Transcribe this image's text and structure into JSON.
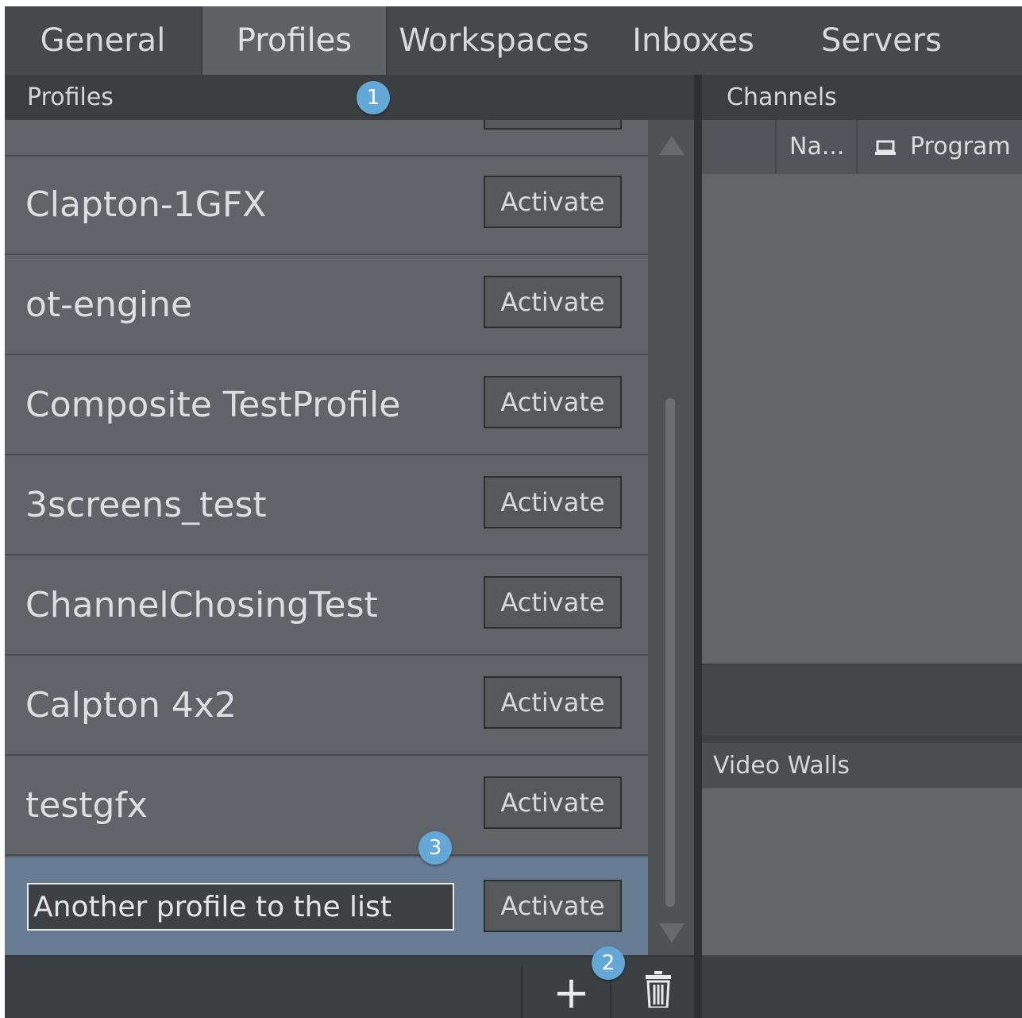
{
  "tabs": [
    {
      "label": "General",
      "active": false
    },
    {
      "label": "Profiles",
      "active": true
    },
    {
      "label": "Workspaces",
      "active": false
    },
    {
      "label": "Inboxes",
      "active": false
    },
    {
      "label": "Servers",
      "active": false
    }
  ],
  "profiles_panel": {
    "title": "Profiles",
    "activate_label": "Activate",
    "items": [
      {
        "name": "Clapton-1GFX"
      },
      {
        "name": "ot-engine"
      },
      {
        "name": "Composite TestProfile"
      },
      {
        "name": "3screens_test"
      },
      {
        "name": "ChannelChosingTest"
      },
      {
        "name": "Calpton 4x2"
      },
      {
        "name": "testgfx"
      }
    ],
    "new_item_value": "Another profile to the list"
  },
  "toolbar": {
    "add_icon": "plus-icon",
    "delete_icon": "trash-icon"
  },
  "callouts": {
    "one": "1",
    "two": "2",
    "three": "3"
  },
  "channels_panel": {
    "title": "Channels",
    "columns": {
      "name": "Na...",
      "program": "Program"
    }
  },
  "video_walls": {
    "title": "Video Walls"
  }
}
